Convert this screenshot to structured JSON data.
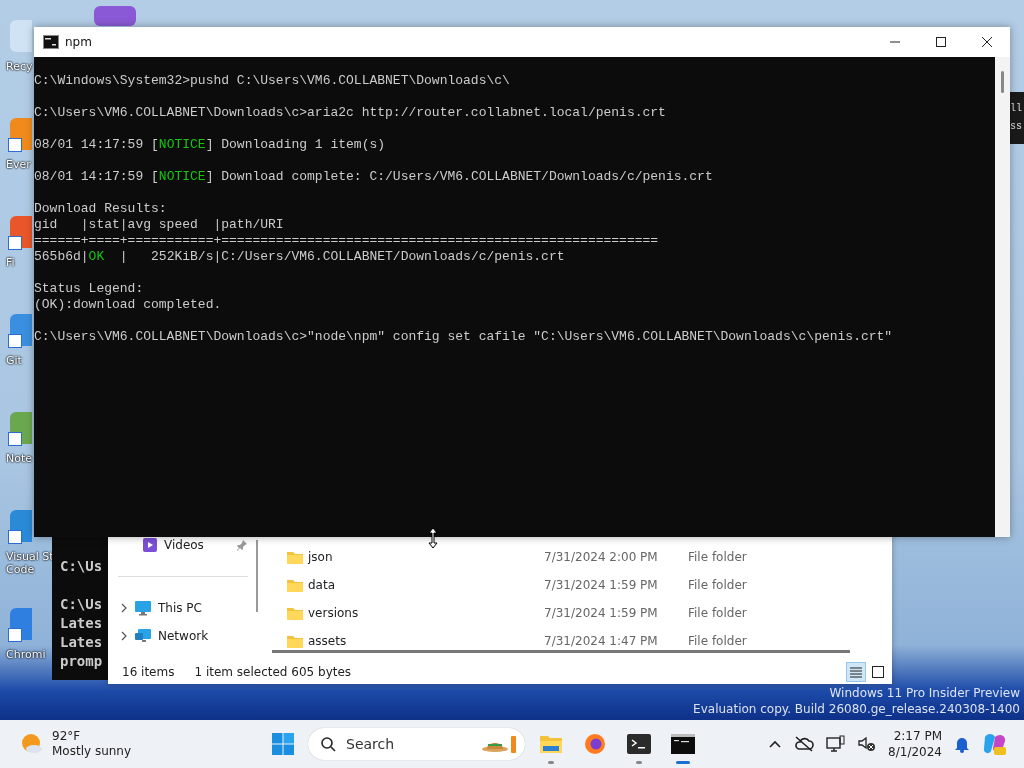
{
  "desktop_icons": [
    {
      "label": [
        "Recy"
      ],
      "kind": "bin"
    },
    {
      "label": [
        "Ever"
      ],
      "kind": "search"
    },
    {
      "label": [
        "Fi"
      ],
      "kind": "fox"
    },
    {
      "label": [
        "Git"
      ],
      "kind": "git"
    },
    {
      "label": [
        "Note"
      ],
      "kind": "notepad"
    },
    {
      "label": [
        "Visual St",
        "Code"
      ],
      "kind": "editor"
    },
    {
      "label": [
        "Chromi"
      ],
      "kind": "chromium"
    }
  ],
  "back_terminal": {
    "blocks": [
      [
        "C:\\Us"
      ],
      [
        "C:\\Us",
        "Lates",
        "Lates",
        "promp"
      ]
    ]
  },
  "right_fragment": {
    "lines": [
      "ll",
      "ss"
    ]
  },
  "terminal": {
    "title": "npm",
    "blocks": [
      [
        {
          "parts": [
            {
              "text": "C:\\Windows\\System32>pushd C:\\Users\\VM6.COLLABNET\\Downloads\\c\\"
            }
          ]
        }
      ],
      [
        {
          "parts": [
            {
              "text": "C:\\Users\\VM6.COLLABNET\\Downloads\\c>aria2c http://router.collabnet.local/penis.crt"
            }
          ]
        }
      ],
      [
        {
          "parts": [
            {
              "text": "08/01 14:17:59 ["
            },
            {
              "text": "NOTICE",
              "color": "#16c60c"
            },
            {
              "text": "] Downloading 1 item(s)"
            }
          ]
        }
      ],
      [
        {
          "parts": [
            {
              "text": "08/01 14:17:59 ["
            },
            {
              "text": "NOTICE",
              "color": "#16c60c"
            },
            {
              "text": "] Download complete: C:/Users/VM6.COLLABNET/Downloads/c/penis.crt"
            }
          ]
        }
      ],
      [
        {
          "parts": [
            {
              "text": "Download Results:"
            }
          ]
        },
        {
          "parts": [
            {
              "text": "gid   |stat|avg speed  |path/URI"
            }
          ]
        },
        {
          "parts": [
            {
              "text": "======+====+===========+========================================================"
            }
          ]
        },
        {
          "parts": [
            {
              "text": "565b6d|"
            },
            {
              "text": "OK",
              "color": "#16c60c"
            },
            {
              "text": "  |   252KiB/s|C:/Users/VM6.COLLABNET/Downloads/c/penis.crt"
            }
          ]
        }
      ],
      [
        {
          "parts": [
            {
              "text": "Status Legend:"
            }
          ]
        },
        {
          "parts": [
            {
              "text": "(OK):download completed."
            }
          ]
        }
      ],
      [
        {
          "parts": [
            {
              "text": "C:\\Users\\VM6.COLLABNET\\Downloads\\c>\"node\\npm\" config set cafile \"C:\\Users\\VM6.COLLABNET\\Downloads\\c\\penis.crt\""
            }
          ]
        }
      ]
    ]
  },
  "explorer": {
    "nav": [
      {
        "label": "Videos",
        "kind": "videos",
        "pinned": true
      },
      {
        "label": "This PC",
        "kind": "pc",
        "pinned": false
      },
      {
        "label": "Network",
        "kind": "network",
        "pinned": false
      }
    ],
    "files": [
      {
        "name": "json",
        "date": "7/31/2024 2:00 PM",
        "type": "File folder"
      },
      {
        "name": "data",
        "date": "7/31/2024 1:59 PM",
        "type": "File folder"
      },
      {
        "name": "versions",
        "date": "7/31/2024 1:59 PM",
        "type": "File folder"
      },
      {
        "name": "assets",
        "date": "7/31/2024 1:47 PM",
        "type": "File folder"
      }
    ],
    "status_count": "16 items",
    "status_selection": "1 item selected  605 bytes",
    "views": [
      {
        "kind": "details",
        "selected": true
      },
      {
        "kind": "tiles",
        "selected": false
      }
    ]
  },
  "watermark": [
    "Windows 11 Pro Insider Preview",
    "Evaluation copy. Build 26080.ge_release.240308-1400"
  ],
  "taskbar": {
    "weather": {
      "temp": "92°F",
      "text": "Mostly sunny"
    },
    "search_placeholder": "Search",
    "apps": [
      {
        "kind": "folder",
        "running": true,
        "selected": false
      },
      {
        "kind": "browser",
        "running": false,
        "selected": false
      },
      {
        "kind": "terminal",
        "running": true,
        "selected": false
      },
      {
        "kind": "console",
        "running": true,
        "selected": true
      }
    ],
    "time": "2:17 PM",
    "date": "8/1/2024"
  }
}
